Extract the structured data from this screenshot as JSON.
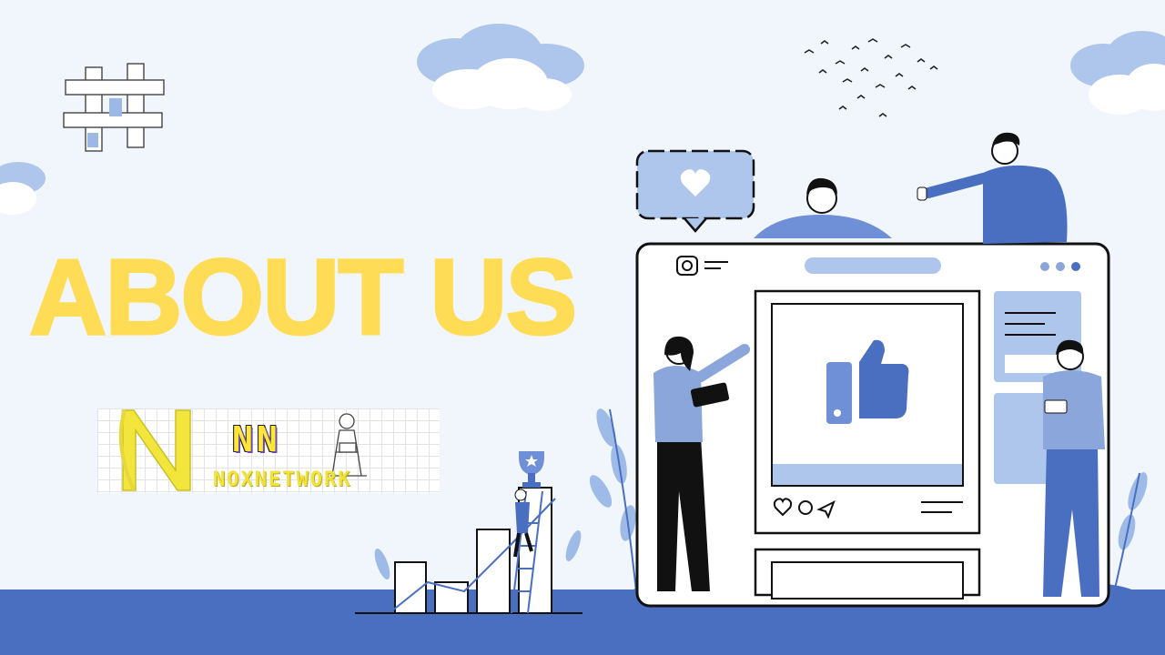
{
  "headline": "ABOUT US",
  "logo": {
    "initials": "NN",
    "name": "NOXNETWORK"
  },
  "colors": {
    "background": "#f1f6fc",
    "headline": "#ffdc55",
    "accent_blue": "#4a6fc1",
    "light_blue": "#a9c3ea",
    "logo_yellow": "#f2e23a"
  },
  "icons": [
    "hashtag-icon",
    "heart-icon",
    "thumbs-up-icon",
    "instagram-icon",
    "comment-icon",
    "send-icon",
    "trophy-icon"
  ]
}
